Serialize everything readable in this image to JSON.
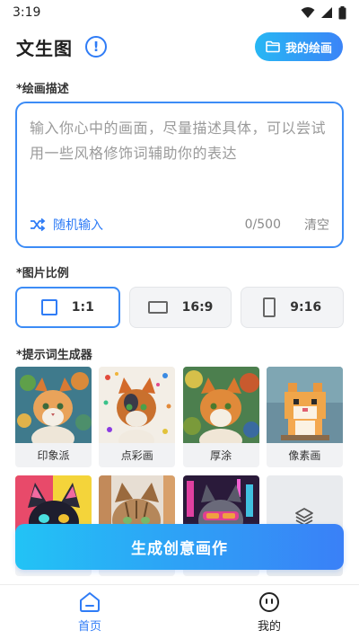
{
  "status_bar": {
    "time": "3:19"
  },
  "header": {
    "title": "文生图",
    "info_icon": "!",
    "my_paintings_label": "我的绘画"
  },
  "description": {
    "label": "*绘画描述",
    "placeholder": "输入你心中的画面，尽量描述具体，可以尝试用一些风格修饰词辅助你的表达",
    "random_label": "随机输入",
    "count": "0/500",
    "clear_label": "清空"
  },
  "ratio": {
    "label": "*图片比例",
    "options": [
      {
        "label": "1:1",
        "selected": true
      },
      {
        "label": "16:9",
        "selected": false
      },
      {
        "label": "9:16",
        "selected": false
      }
    ]
  },
  "prompt_generator": {
    "label": "*提示词生成器",
    "styles": [
      {
        "name": "印象派"
      },
      {
        "name": "点彩画"
      },
      {
        "name": "厚涂"
      },
      {
        "name": "像素画"
      }
    ]
  },
  "generate_label": "生成创意画作",
  "bottom_nav": {
    "items": [
      {
        "label": "首页",
        "active": true
      },
      {
        "label": "我的",
        "active": false
      }
    ]
  },
  "colors": {
    "accent": "#2f7cf6",
    "gradient_start": "#22c3f5",
    "gradient_end": "#3a80f7"
  }
}
